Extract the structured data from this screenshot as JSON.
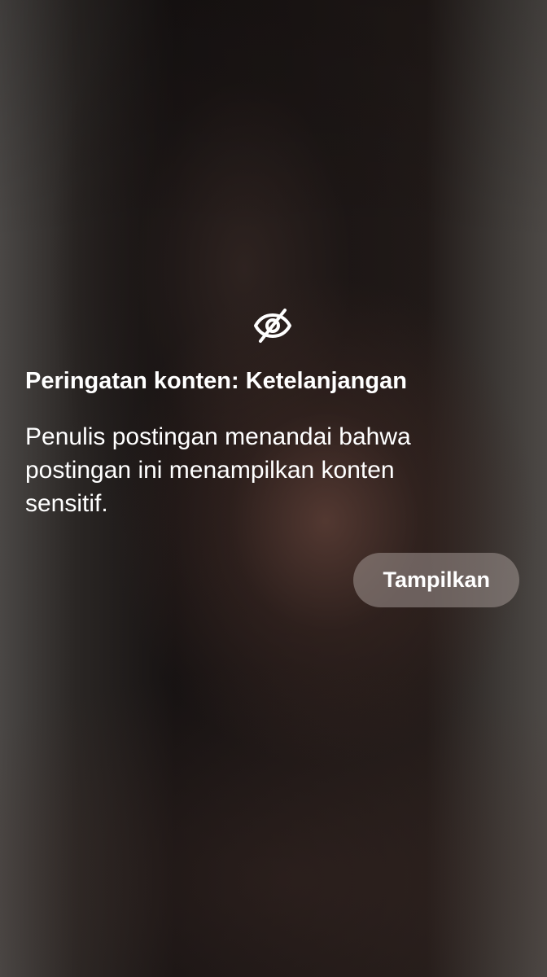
{
  "warning": {
    "icon": "eye-slash-icon",
    "title": "Peringatan konten: Ketelanjangan",
    "description": "Penulis postingan menandai bahwa postingan ini menampilkan konten sensitif.",
    "show_button_label": "Tampilkan"
  },
  "colors": {
    "text": "#ffffff",
    "button_background": "#8f8582"
  }
}
